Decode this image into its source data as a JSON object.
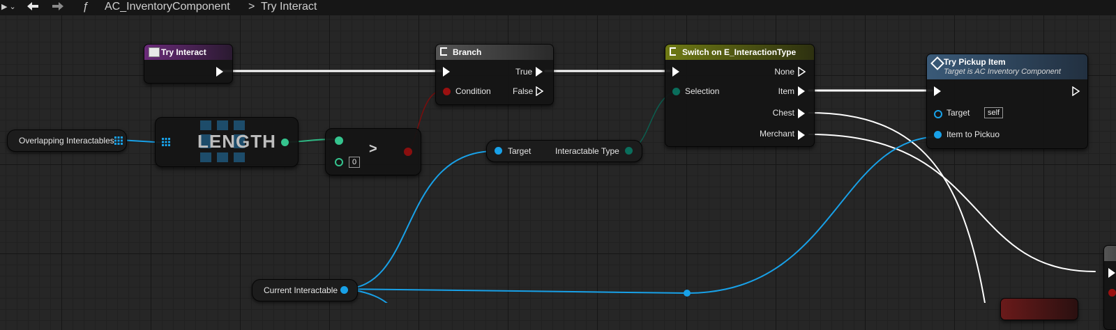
{
  "breadcrumb": {
    "function_glyph": "ƒ",
    "component": "AC_InventoryComponent",
    "separator": ">",
    "function": "Try Interact"
  },
  "nodes": {
    "try_interact": {
      "title": "Try Interact",
      "color": "#6a2a79"
    },
    "branch": {
      "title": "Branch",
      "condition": "Condition",
      "true": "True",
      "false": "False"
    },
    "switch": {
      "title": "Switch on E_InteractionType",
      "selection": "Selection",
      "cases": [
        "None",
        "Item",
        "Chest",
        "Merchant"
      ]
    },
    "try_pickup": {
      "title": "Try Pickup Item",
      "subtitle": "Target is AC Inventory Component",
      "target": "Target",
      "target_value": "self",
      "item": "Item to Pickuo"
    },
    "length": {
      "label": "LENGTH"
    },
    "greater": {
      "op": ">",
      "b_value": "0"
    },
    "overlapping": {
      "label": "Overlapping Interactables"
    },
    "get_type": {
      "target": "Target",
      "output": "Interactable Type"
    },
    "current": {
      "label": "Current Interactable"
    }
  },
  "colors": {
    "exec": "#ffffff",
    "object": "#18a1e8",
    "bool": "#8a0f0f",
    "int": "#35c48e",
    "byte": "#0a6e5c"
  }
}
